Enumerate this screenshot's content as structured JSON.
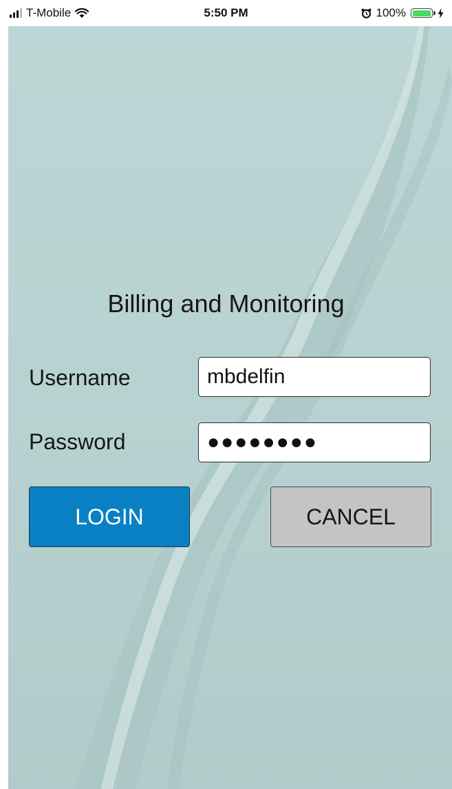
{
  "status_bar": {
    "carrier": "T-Mobile",
    "time": "5:50 PM",
    "battery_percent": "100%",
    "battery_level": 1.0,
    "icons": [
      "signal-icon",
      "wifi-icon",
      "alarm-icon",
      "battery-icon",
      "charging-icon"
    ]
  },
  "app": {
    "title": "Billing and Monitoring",
    "background_color": "#bcd6d5"
  },
  "form": {
    "username_label": "Username",
    "username_value": "mbdelfin",
    "password_label": "Password",
    "password_value": "●●●●●●●●"
  },
  "buttons": {
    "login_label": "LOGIN",
    "login_color": "#0a80c4",
    "cancel_label": "CANCEL",
    "cancel_color": "#c4c4c4"
  }
}
